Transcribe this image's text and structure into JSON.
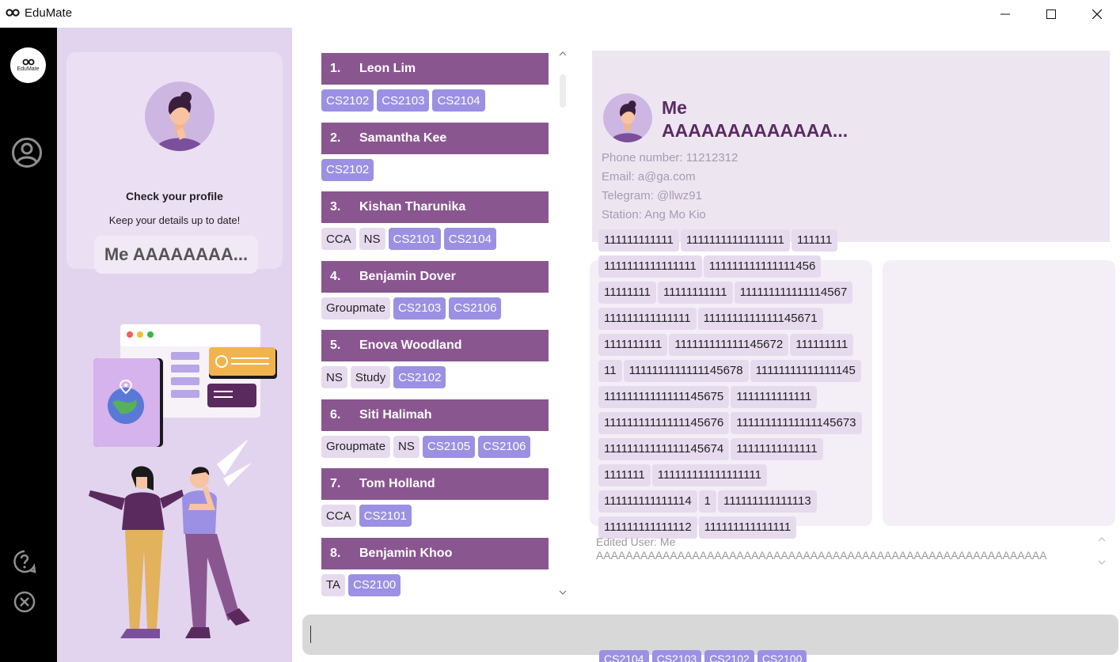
{
  "window": {
    "title": "EduMate"
  },
  "sidebar": {
    "logo_text": "EduMate",
    "icons": [
      "profile-icon",
      "help-icon",
      "exit-icon"
    ]
  },
  "profile": {
    "check_title": "Check your profile",
    "keep_text": "Keep your details up to date!",
    "name_pill": "Me  AAAAAAAA..."
  },
  "contacts": [
    {
      "index": "1.",
      "name": "Leon Lim",
      "tags": [
        {
          "label": "CS2102",
          "kind": "module"
        },
        {
          "label": "CS2103",
          "kind": "module"
        },
        {
          "label": "CS2104",
          "kind": "module"
        }
      ]
    },
    {
      "index": "2.",
      "name": "Samantha Kee",
      "tags": [
        {
          "label": "CS2102",
          "kind": "module"
        }
      ]
    },
    {
      "index": "3.",
      "name": "Kishan Tharunika",
      "tags": [
        {
          "label": "CCA",
          "kind": "plain"
        },
        {
          "label": "NS",
          "kind": "plain"
        },
        {
          "label": "CS2101",
          "kind": "module"
        },
        {
          "label": "CS2104",
          "kind": "module"
        }
      ]
    },
    {
      "index": "4.",
      "name": "Benjamin Dover",
      "tags": [
        {
          "label": "Groupmate",
          "kind": "plain"
        },
        {
          "label": "CS2103",
          "kind": "module"
        },
        {
          "label": "CS2106",
          "kind": "module"
        }
      ]
    },
    {
      "index": "5.",
      "name": "Enova Woodland",
      "tags": [
        {
          "label": "NS",
          "kind": "plain"
        },
        {
          "label": "Study",
          "kind": "plain"
        },
        {
          "label": "CS2102",
          "kind": "module"
        }
      ]
    },
    {
      "index": "6.",
      "name": "Siti Halimah",
      "tags": [
        {
          "label": "Groupmate",
          "kind": "plain"
        },
        {
          "label": "NS",
          "kind": "plain"
        },
        {
          "label": "CS2105",
          "kind": "module"
        },
        {
          "label": "CS2106",
          "kind": "module"
        }
      ]
    },
    {
      "index": "7.",
      "name": "Tom Holland",
      "tags": [
        {
          "label": "CCA",
          "kind": "plain"
        },
        {
          "label": "CS2101",
          "kind": "module"
        }
      ]
    },
    {
      "index": "8.",
      "name": "Benjamin Khoo",
      "tags": [
        {
          "label": "TA",
          "kind": "plain"
        },
        {
          "label": "CS2100",
          "kind": "module"
        }
      ]
    }
  ],
  "detail": {
    "name_line1": "Me",
    "name_line2": "AAAAAAAAAAAAA...",
    "phone": "Phone number: 11212312",
    "email": "Email: a@ga.com",
    "telegram": "Telegram: @llwz91",
    "station": "Station: Ang Mo Kio",
    "tags": [
      "111111111111",
      "11111111111111111",
      "111111",
      "1111111111111111",
      "111111111111111456",
      "11111111",
      "11111111111",
      "111111111111114567",
      "111111111111111",
      "1111111111111145671",
      "1111111111",
      "111111111111145672",
      "111111111",
      "11",
      "1111111111111145678",
      "11111111111111145",
      "11111111111111145675",
      "1111111111111",
      "11111111111111145676",
      "11111111111111145673",
      "11111111111111145674",
      "11111111111111",
      "1111111",
      "111111111111111111",
      "111111111111114",
      "1",
      "111111111111113",
      "111111111111112",
      "111111111111111"
    ],
    "bottom_tags": [
      "CS2104",
      "CS2103",
      "CS2102",
      "CS2100"
    ]
  },
  "result": {
    "line1": "Edited User: Me",
    "line2": "AAAAAAAAAAAAAAAAAAAAAAAAAAAAAAAAAAAAAAAAAAAAAAAAAAAAAAAAAAAAA"
  },
  "command": {
    "value": ""
  },
  "colors": {
    "accent": "#8a5690",
    "module_tag": "#9b90e3",
    "plain_tag": "#e6dbee",
    "profile_panel": "#e2d4ee",
    "sidebar": "#000000"
  }
}
